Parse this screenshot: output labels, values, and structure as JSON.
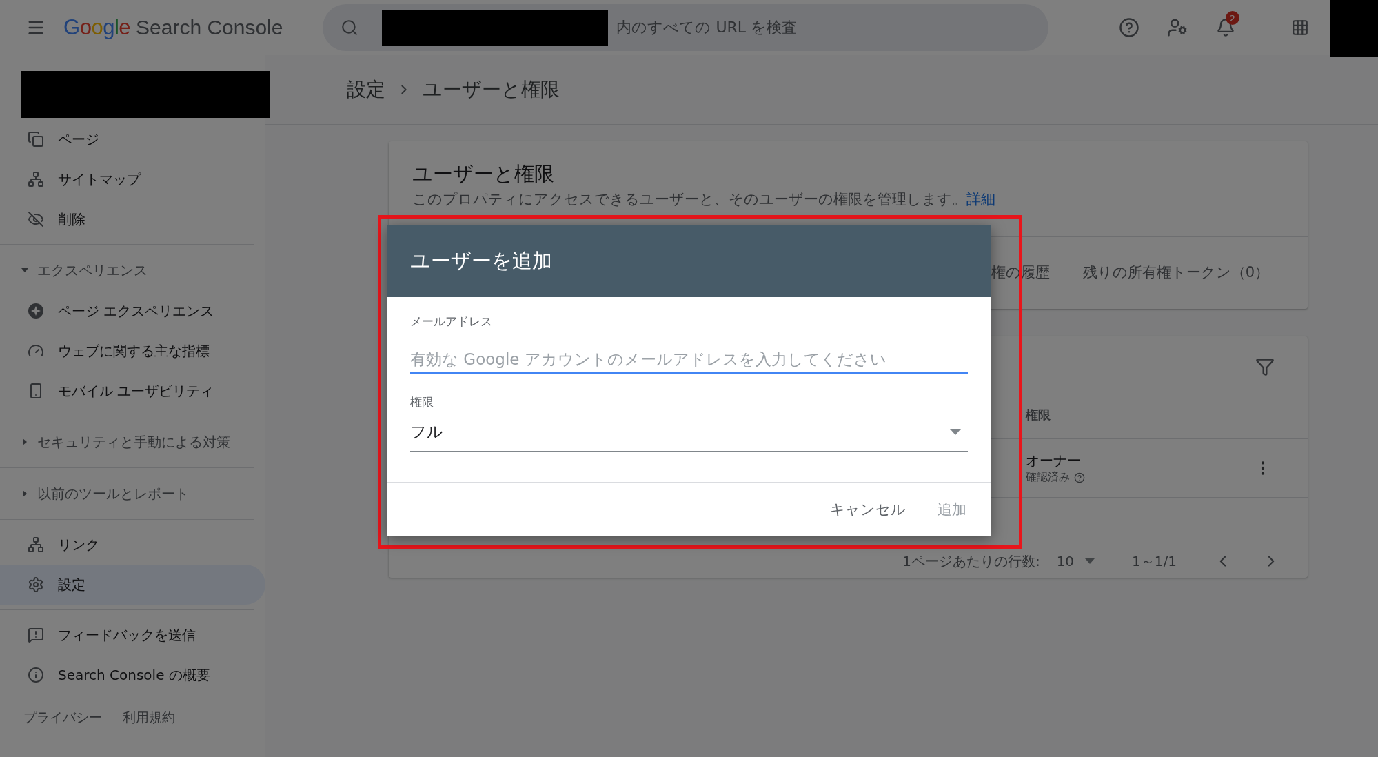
{
  "header": {
    "logo": "Google",
    "product": "Search Console",
    "search": {
      "placeholder": "内のすべての URL を検査"
    },
    "notifications": {
      "badge": "2"
    }
  },
  "sidebar": {
    "groups": [
      {
        "items": [
          {
            "label": "ページ",
            "selected": false
          },
          {
            "label": "サイトマップ",
            "selected": false
          },
          {
            "label": "削除",
            "selected": false
          }
        ]
      },
      {
        "section": {
          "label": "エクスペリエンス",
          "expanded": true
        },
        "items": [
          {
            "label": "ページ エクスペリエンス",
            "selected": false
          },
          {
            "label": "ウェブに関する主な指標",
            "selected": false
          },
          {
            "label": "モバイル ユーザビリティ",
            "selected": false
          }
        ]
      },
      {
        "section": {
          "label": "セキュリティと手動による対策",
          "expanded": false
        }
      },
      {
        "section": {
          "label": "以前のツールとレポート",
          "expanded": false
        }
      },
      {
        "items": [
          {
            "label": "リンク",
            "selected": false
          },
          {
            "label": "設定",
            "selected": true
          }
        ]
      },
      {
        "items": [
          {
            "label": "フィードバックを送信",
            "selected": false
          },
          {
            "label": "Search Console の概要",
            "selected": false
          }
        ]
      }
    ],
    "footer_links": [
      "プライバシー",
      "利用規約"
    ]
  },
  "breadcrumb": [
    "設定",
    "ユーザーと権限"
  ],
  "users_card": {
    "title": "ユーザーと権限",
    "description": "このプロパティにアクセスできるユーザーと、そのユーザーの権限を管理します。",
    "link": "詳細",
    "tabs": [
      {
        "label": "権の履歴",
        "selected": false
      },
      {
        "label": "残りの所有権トークン（0）",
        "selected": false
      }
    ]
  },
  "table": {
    "columns": [
      "権限"
    ],
    "rows": [
      {
        "role": "オーナー",
        "status": "確認済み"
      }
    ],
    "pagination": {
      "rows_label": "1ページあたりの行数:",
      "rows_per_page": "10",
      "range": "1～1/1"
    }
  },
  "dialog": {
    "title": "ユーザーを追加",
    "fields": [
      {
        "kind": "text",
        "label": "メールアドレス",
        "placeholder": "有効な Google アカウントのメールアドレスを入力してください",
        "focused": true
      },
      {
        "kind": "select",
        "label": "権限",
        "value": "フル",
        "focused": false
      }
    ],
    "buttons": [
      {
        "label": "キャンセル",
        "disabled": false
      },
      {
        "label": "追加",
        "disabled": true
      }
    ]
  }
}
